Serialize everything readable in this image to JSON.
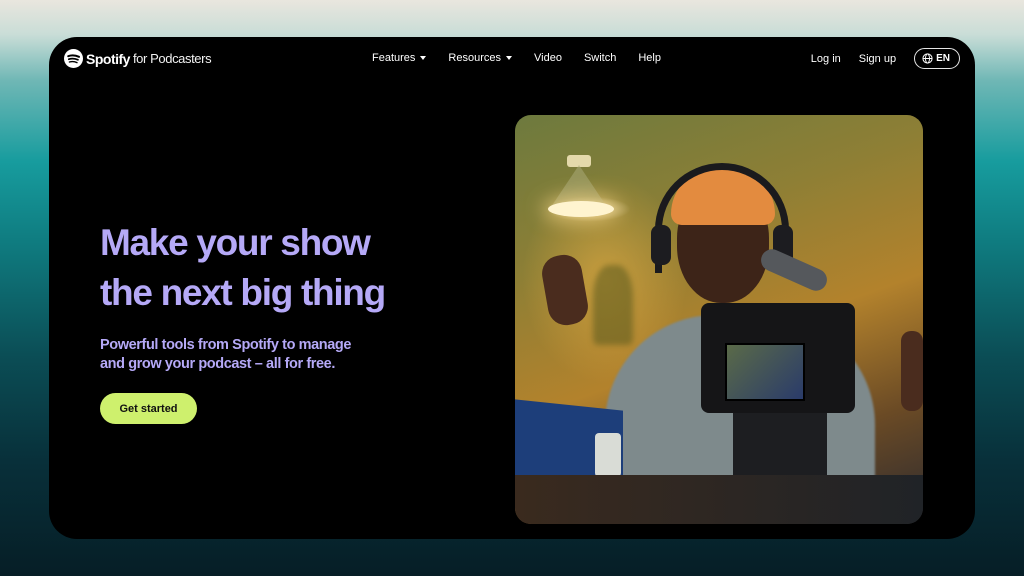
{
  "brand": {
    "name": "Spotify",
    "suffix": "for Podcasters",
    "logo_icon": "spotify-logo-icon"
  },
  "nav": {
    "items": [
      {
        "label": "Features",
        "dropdown": true
      },
      {
        "label": "Resources",
        "dropdown": true
      },
      {
        "label": "Video",
        "dropdown": false
      },
      {
        "label": "Switch",
        "dropdown": false
      },
      {
        "label": "Help",
        "dropdown": false
      }
    ],
    "login": "Log in",
    "signup": "Sign up",
    "language": {
      "icon": "globe-icon",
      "label": "EN"
    }
  },
  "hero": {
    "title_line1": "Make your show",
    "title_line2": "the next big thing",
    "subtitle_line1": "Powerful tools from Spotify to manage",
    "subtitle_line2": "and grow your podcast – all for free.",
    "cta_label": "Get started",
    "image_description": "Podcaster in orange beanie and headphones gesturing at a camera with a microphone, lamp in background"
  },
  "colors": {
    "headline": "#b5a9f7",
    "cta_background": "#cef06d",
    "page_background": "#000000"
  }
}
